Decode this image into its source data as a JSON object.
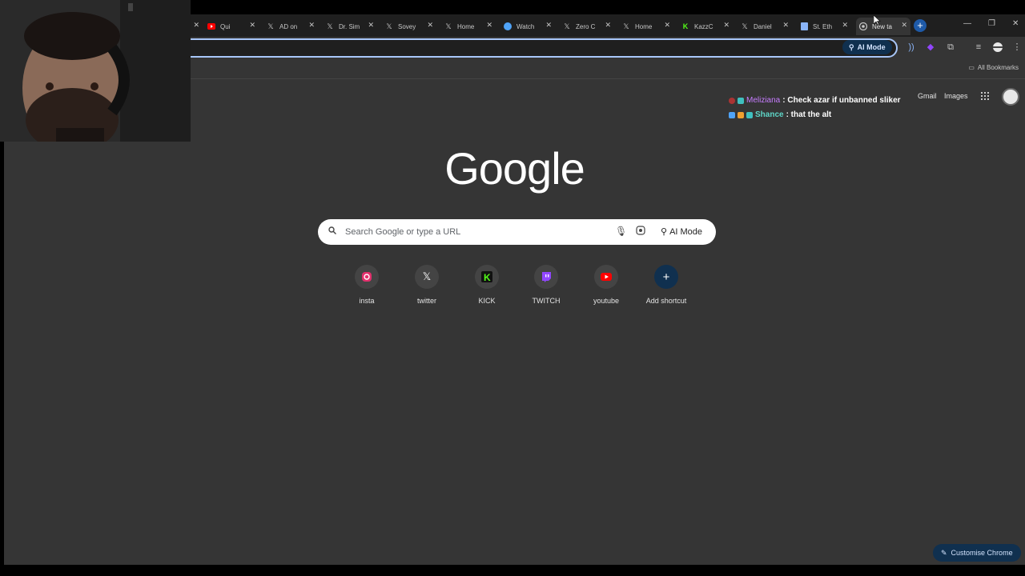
{
  "tabs": [
    {
      "title": "Qui",
      "icon": "youtube-icon",
      "color": "#ff0000"
    },
    {
      "title": "AD on",
      "icon": "x-icon",
      "color": "#ffffff"
    },
    {
      "title": "Dr. Sim",
      "icon": "x-icon",
      "color": "#ffffff"
    },
    {
      "title": "Sovey",
      "icon": "x-icon",
      "color": "#ffffff"
    },
    {
      "title": "Home",
      "icon": "x-icon",
      "color": "#ffffff"
    },
    {
      "title": "Watch",
      "icon": "watch-icon",
      "color": "#4fa3f7"
    },
    {
      "title": "Zero C",
      "icon": "x-icon",
      "color": "#ffffff"
    },
    {
      "title": "Home",
      "icon": "x-icon",
      "color": "#ffffff"
    },
    {
      "title": "KazzC",
      "icon": "kick-icon",
      "color": "#53fc18"
    },
    {
      "title": "Daniel",
      "icon": "x-icon",
      "color": "#ffffff"
    },
    {
      "title": "St. Eth",
      "icon": "page-icon",
      "color": "#8ab4f8"
    },
    {
      "title": "New ta",
      "icon": "chrome-icon",
      "color": "#c7c7c7",
      "active": true
    }
  ],
  "toolbar": {
    "ai_mode_label": "AI Mode",
    "all_bookmarks_label": "All Bookmarks"
  },
  "header": {
    "gmail_label": "Gmail",
    "images_label": "Images"
  },
  "chat_overlay": [
    {
      "user": "Meliziana",
      "user_color": "#c77dff",
      "message": ": Check azar if unbanned sliker"
    },
    {
      "user": "Shance",
      "user_color": "#5ed6c8",
      "message": ": that the alt"
    }
  ],
  "logo_text": "Google",
  "search": {
    "placeholder": "Search Google or type a URL",
    "ai_mode_label": "AI Mode"
  },
  "shortcuts": [
    {
      "label": "insta",
      "icon": "instagram-icon",
      "color": "#e1306c"
    },
    {
      "label": "twitter",
      "icon": "x-icon",
      "color": "#ffffff"
    },
    {
      "label": "KICK",
      "icon": "kick-icon",
      "color": "#53fc18"
    },
    {
      "label": "TWITCH",
      "icon": "twitch-icon",
      "color": "#9146ff"
    },
    {
      "label": "youtube",
      "icon": "youtube-icon",
      "color": "#ff0000"
    },
    {
      "label": "Add shortcut",
      "icon": "plus-icon",
      "color": "#ffffff"
    }
  ],
  "customise_label": "Customise Chrome"
}
